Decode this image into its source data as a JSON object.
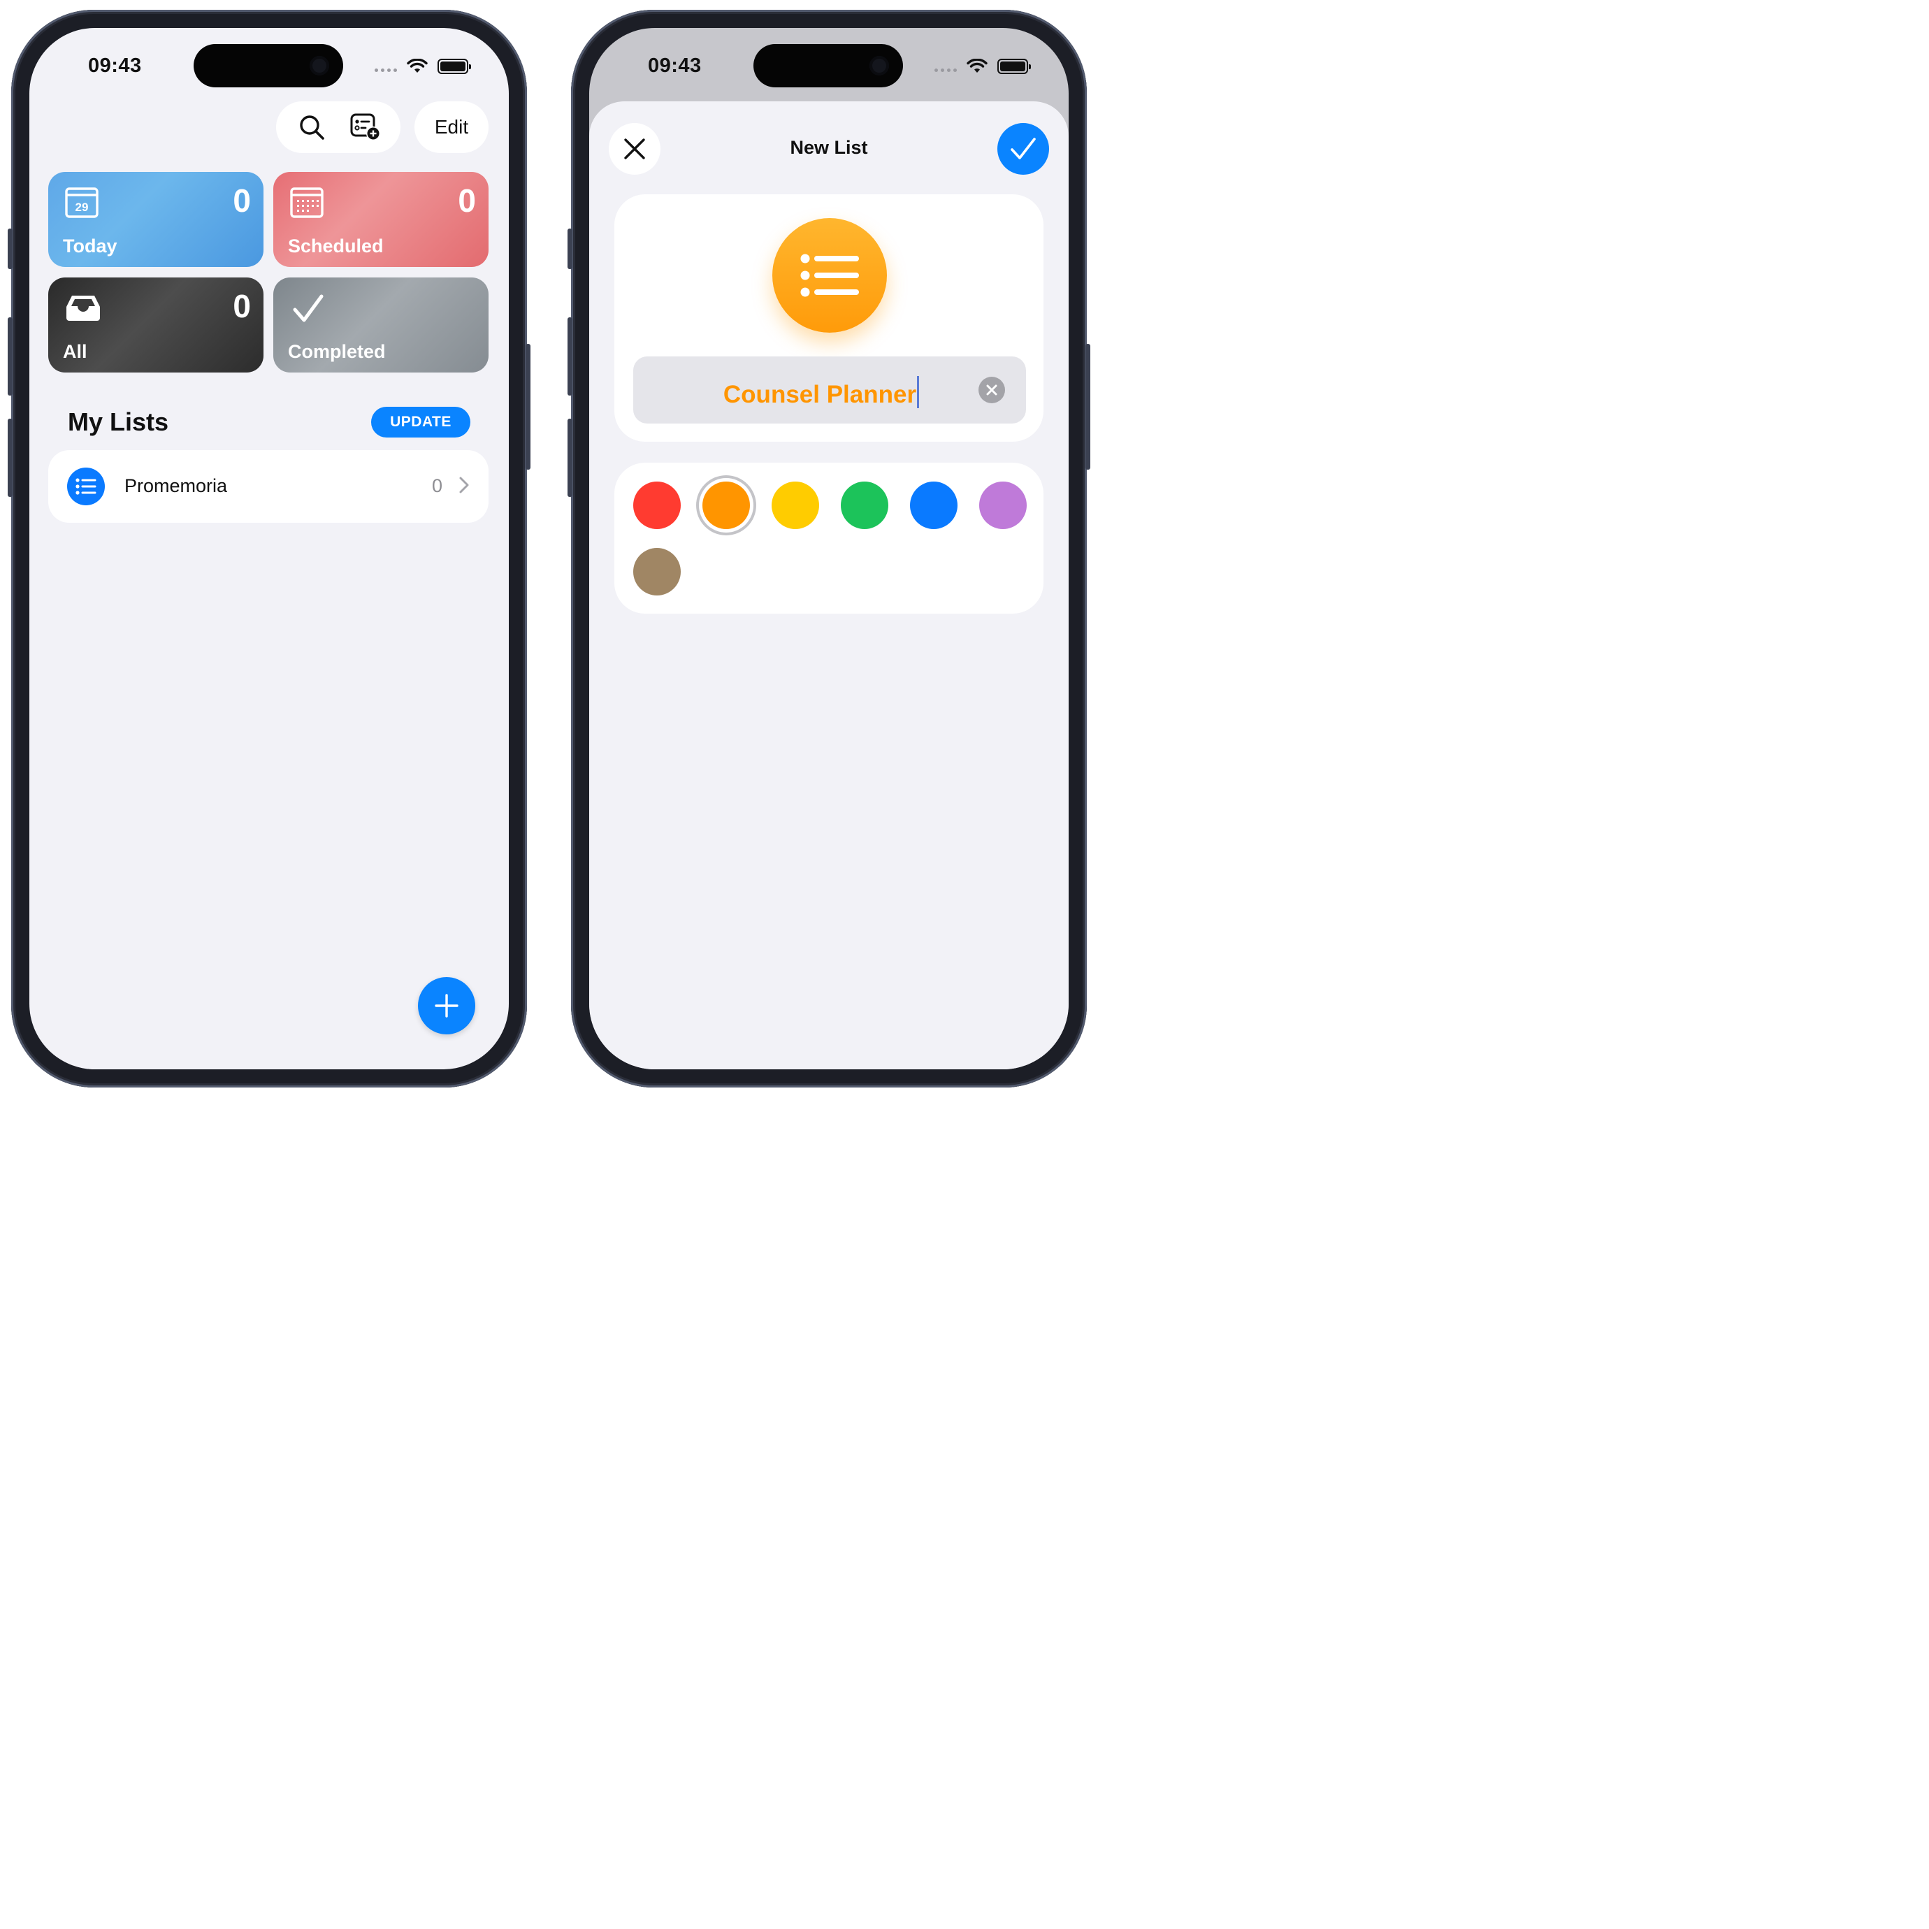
{
  "left_screen": {
    "status": {
      "time": "09:43"
    },
    "toolbar": {
      "search_icon": "search-icon",
      "list_add_icon": "list-add-icon",
      "edit_label": "Edit"
    },
    "smart_lists": [
      {
        "label": "Today",
        "count": "0",
        "icon": "calendar-day-icon",
        "day": "29",
        "color": "#5fa8e8"
      },
      {
        "label": "Scheduled",
        "count": "0",
        "icon": "calendar-grid-icon",
        "color": "#e66e74"
      },
      {
        "label": "All",
        "count": "0",
        "icon": "tray-icon",
        "color": "#3a3a3a"
      },
      {
        "label": "Completed",
        "count": "",
        "icon": "checkmark-icon",
        "color": "#8e959b"
      }
    ],
    "my_lists": {
      "title": "My Lists",
      "update_label": "UPDATE",
      "items": [
        {
          "name": "Promemoria",
          "count": "0",
          "icon": "list-bullet-icon",
          "color": "#0a7aff"
        }
      ]
    },
    "fab_icon": "plus-icon"
  },
  "right_screen": {
    "status": {
      "time": "09:43"
    },
    "sheet": {
      "title": "New List",
      "close_icon": "close-icon",
      "done_icon": "checkmark-icon",
      "list_icon": "list-bullet-icon",
      "name_value": "Counsel Planner",
      "accent": "#ff9500",
      "colors": [
        {
          "name": "red",
          "hex": "#ff3b30",
          "selected": false
        },
        {
          "name": "orange",
          "hex": "#ff9500",
          "selected": true
        },
        {
          "name": "yellow",
          "hex": "#ffcc00",
          "selected": false
        },
        {
          "name": "green",
          "hex": "#1cc35a",
          "selected": false
        },
        {
          "name": "blue",
          "hex": "#0a7aff",
          "selected": false
        },
        {
          "name": "purple",
          "hex": "#bf7ad9",
          "selected": false
        },
        {
          "name": "brown",
          "hex": "#a08664",
          "selected": false
        }
      ]
    }
  }
}
